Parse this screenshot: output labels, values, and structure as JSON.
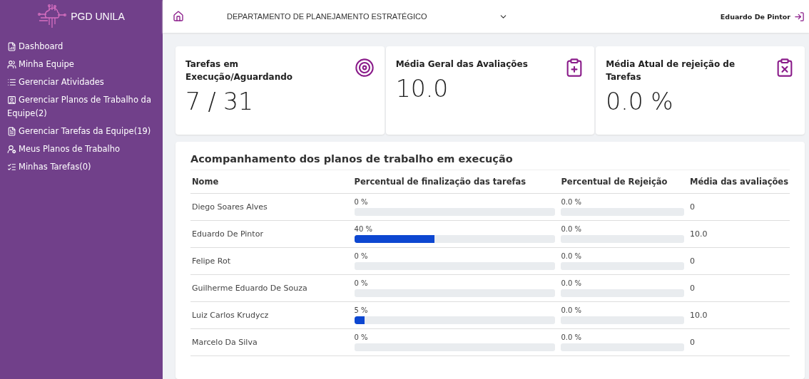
{
  "brand": {
    "name": "PGD UNILA"
  },
  "sidebar": {
    "items": [
      {
        "label": "Dashboard"
      },
      {
        "label": "Minha Equipe"
      },
      {
        "label": "Gerenciar Atividades"
      },
      {
        "label": "Gerenciar Planos de Trabalho da Equipe(2)"
      },
      {
        "label": "Gerenciar Tarefas da Equipe(19)"
      },
      {
        "label": "Meus Planos de Trabalho"
      },
      {
        "label": "Minhas Tarefas(0)"
      }
    ]
  },
  "header": {
    "department": "DEPARTAMENTO DE PLANEJAMENTO ESTRATÉGICO",
    "user": "Eduardo De Pintor"
  },
  "cards": [
    {
      "title": "Tarefas em Execução/Aguardando",
      "value": "7 / 31"
    },
    {
      "title": "Média Geral das Avaliações",
      "value": "10.0"
    },
    {
      "title": "Média Atual de rejeição de Tarefas",
      "value": "0.0 %"
    }
  ],
  "table": {
    "title": "Acompanhamento dos planos de trabalho em execução",
    "columns": [
      "Nome",
      "Percentual de finalização das tarefas",
      "Percentual de Rejeição",
      "Média das avaliações"
    ],
    "rows": [
      {
        "name": "Diego Soares Alves",
        "completion": {
          "text": "0 %"
        },
        "rejection": {
          "text": "0.0 %"
        },
        "average": "0"
      },
      {
        "name": "Eduardo De Pintor",
        "completion": {
          "text": "40 %",
          "level": 0.4
        },
        "rejection": {
          "text": "0.0 %"
        },
        "average": "10.0"
      },
      {
        "name": "Felipe Rot",
        "completion": {
          "text": "0 %"
        },
        "rejection": {
          "text": "0.0 %"
        },
        "average": "0"
      },
      {
        "name": "Guilherme Eduardo De Souza",
        "completion": {
          "text": "0 %"
        },
        "rejection": {
          "text": "0.0 %"
        },
        "average": "0"
      },
      {
        "name": "Luiz Carlos Krudycz",
        "completion": {
          "text": "5 %",
          "level": 0.05
        },
        "rejection": {
          "text": "0.0 %"
        },
        "average": "10.0"
      },
      {
        "name": "Marcelo Da Silva",
        "completion": {
          "text": "0 %"
        },
        "rejection": {
          "text": "0.0 %"
        },
        "average": "0"
      }
    ]
  }
}
